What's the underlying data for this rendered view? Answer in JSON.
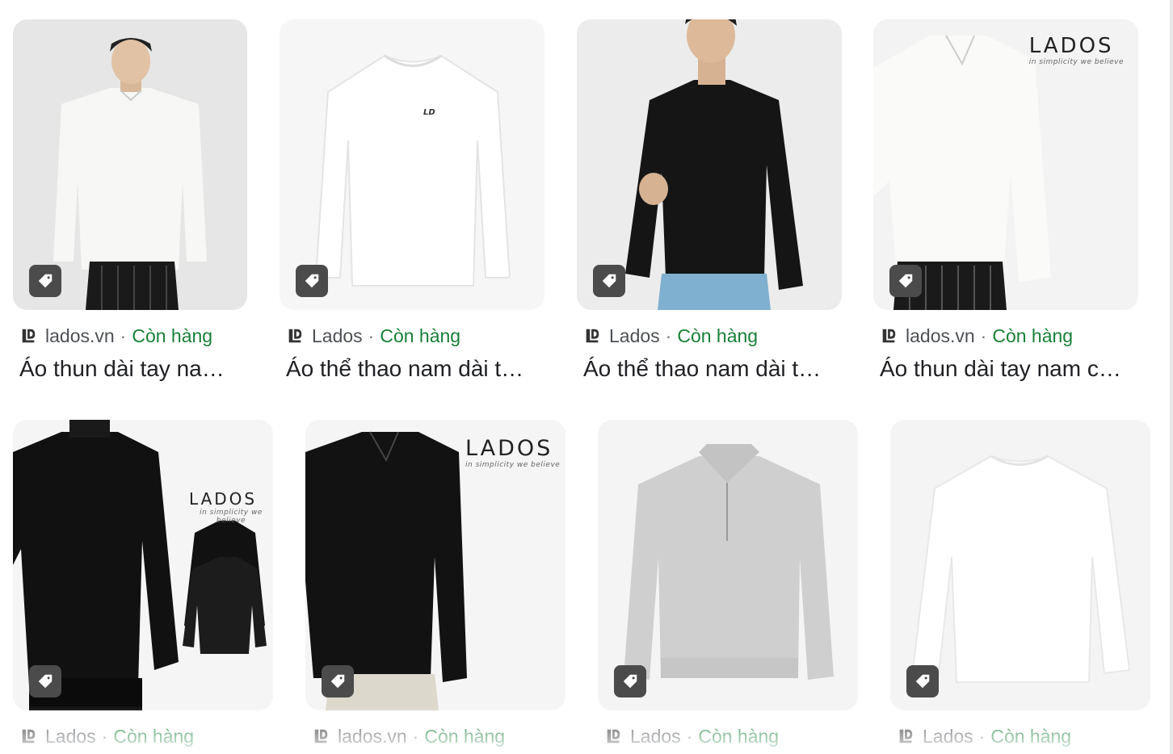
{
  "results": [
    {
      "source": "lados.vn",
      "separator": "·",
      "availability": "Còn hàng",
      "title": "Áo thun dài tay na…",
      "image": "man-white-vneck-shirt"
    },
    {
      "source": "Lados",
      "separator": "·",
      "availability": "Còn hàng",
      "title": "Áo thể thao nam dài t…",
      "image": "white-longsleeve-product"
    },
    {
      "source": "Lados",
      "separator": "·",
      "availability": "Còn hàng",
      "title": "Áo thể thao nam dài t…",
      "image": "man-black-longsleeve"
    },
    {
      "source": "lados.vn",
      "separator": "·",
      "availability": "Còn hàng",
      "title": "Áo thun dài tay nam c…",
      "image": "man-white-vneck-branded",
      "brand": "LADOS",
      "tagline": "in simplicity we believe"
    },
    {
      "source": "Lados",
      "separator": "·",
      "availability": "Còn hàng",
      "title": "",
      "image": "man-black-turtleneck-branded",
      "brand": "LADOS",
      "tagline": "in simplicity we believe"
    },
    {
      "source": "lados.vn",
      "separator": "·",
      "availability": "Còn hàng",
      "title": "",
      "image": "man-black-vneck-branded",
      "brand": "LADOS",
      "tagline": "in simplicity we believe"
    },
    {
      "source": "Lados",
      "separator": "·",
      "availability": "Còn hàng",
      "title": "",
      "image": "grey-zip-polo-product"
    },
    {
      "source": "Lados",
      "separator": "·",
      "availability": "Còn hàng",
      "title": "",
      "image": "white-longsleeve-product"
    }
  ],
  "icons": {
    "shopping_tag": "tag-icon",
    "favicon": "lados-logo-icon"
  },
  "colors": {
    "availability": "#188038",
    "source": "#4d5156",
    "title": "#202124",
    "tag_bg": "#4b4b4b"
  }
}
